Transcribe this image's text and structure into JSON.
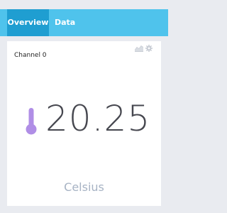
{
  "tabs": [
    {
      "label": "Overview",
      "active": true
    },
    {
      "label": "Data",
      "active": false
    }
  ],
  "card": {
    "title": "Channel 0",
    "value": "20.25",
    "unit": "Celsius",
    "value_icon": "thermometer-icon",
    "actions": [
      "chart-icon",
      "gear-icon"
    ]
  },
  "colors": {
    "tab_bar": "#4fc3ec",
    "tab_active": "#1f9ed1",
    "thermometer": "#b08ee6",
    "value_text": "#46474f",
    "unit_text": "#a7b3c4",
    "icon_gray": "#c7ccd4"
  }
}
